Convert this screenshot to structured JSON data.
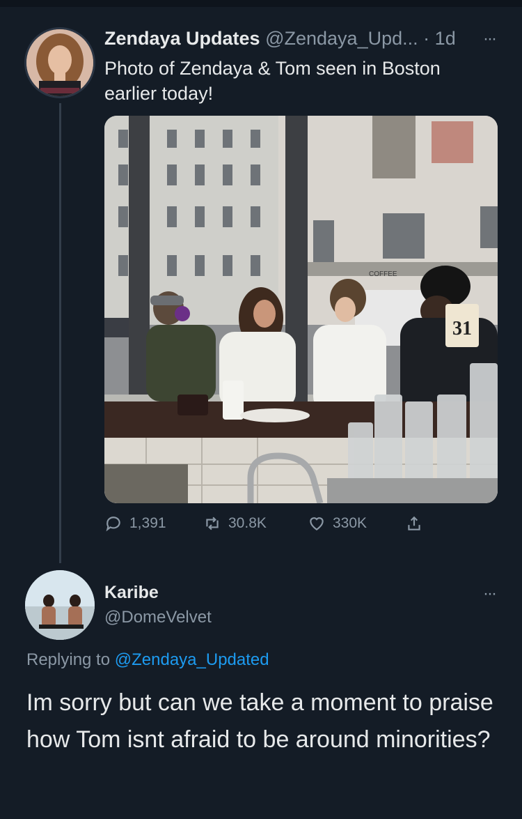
{
  "tweet": {
    "author_name": "Zendaya Updates",
    "author_handle": "@Zendaya_Upd...",
    "separator": "·",
    "time": "1d",
    "more": "···",
    "text": "Photo of Zendaya & Tom seen in Boston earlier today!",
    "avatar_icon": "profile-photo",
    "photo": {
      "storefront_sign": "COFFEE",
      "table_number": "31"
    },
    "stats": {
      "replies": "1,391",
      "retweets": "30.8K",
      "likes": "330K"
    }
  },
  "reply": {
    "author_name": "Karibe",
    "author_handle": "@DomeVelvet",
    "more": "···",
    "replying_prefix": "Replying to",
    "replying_to": "@Zendaya_Updated",
    "text": "Im sorry but can we take a moment to praise how Tom isnt afraid to be around minorities?"
  },
  "colors": {
    "background": "#141c26",
    "text": "#e7e9ea",
    "muted": "#8b98a5",
    "link": "#1d9bf0"
  }
}
